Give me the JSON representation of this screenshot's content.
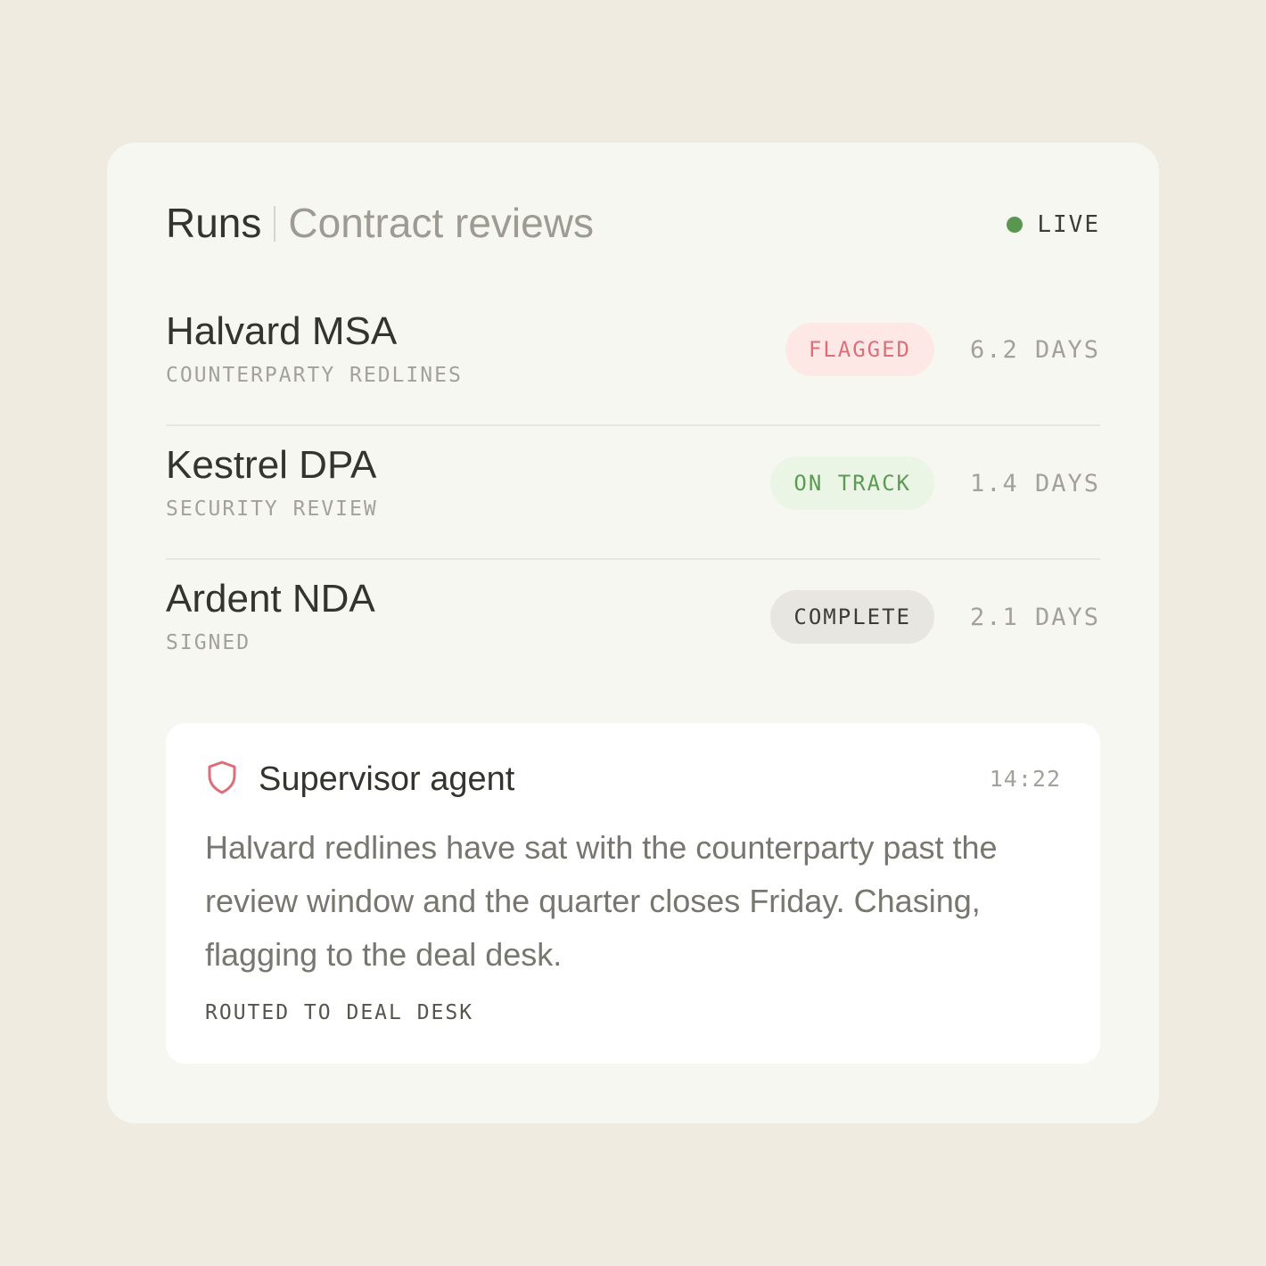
{
  "header": {
    "title": "Runs",
    "subtitle": "Contract reviews",
    "live_label": "LIVE"
  },
  "runs": [
    {
      "name": "Halvard MSA",
      "detail": "COUNTERPARTY REDLINES",
      "status": "FLAGGED",
      "status_kind": "flagged",
      "duration": "6.2 DAYS"
    },
    {
      "name": "Kestrel DPA",
      "detail": "SECURITY REVIEW",
      "status": "ON TRACK",
      "status_kind": "ontrack",
      "duration": "1.4 DAYS"
    },
    {
      "name": "Ardent NDA",
      "detail": "SIGNED",
      "status": "COMPLETE",
      "status_kind": "complete",
      "duration": "2.1 DAYS"
    }
  ],
  "note": {
    "icon": "shield-icon",
    "title": "Supervisor agent",
    "time": "14:22",
    "body": "Halvard redlines have sat with the counterparty past the review window and the quarter closes Friday. Chasing, flagging to the deal desk.",
    "footer": "ROUTED TO DEAL DESK"
  },
  "colors": {
    "page_background": "#f0ebe0",
    "card_background": "#f7f7f2",
    "live": "#5b9650",
    "flagged_text": "#db6f7c",
    "flagged_bg": "#fde8e6",
    "ontrack_text": "#5c9a54",
    "ontrack_bg": "#eaf5e6",
    "complete_bg": "#e7e6e1",
    "shield": "#dc6e79"
  }
}
